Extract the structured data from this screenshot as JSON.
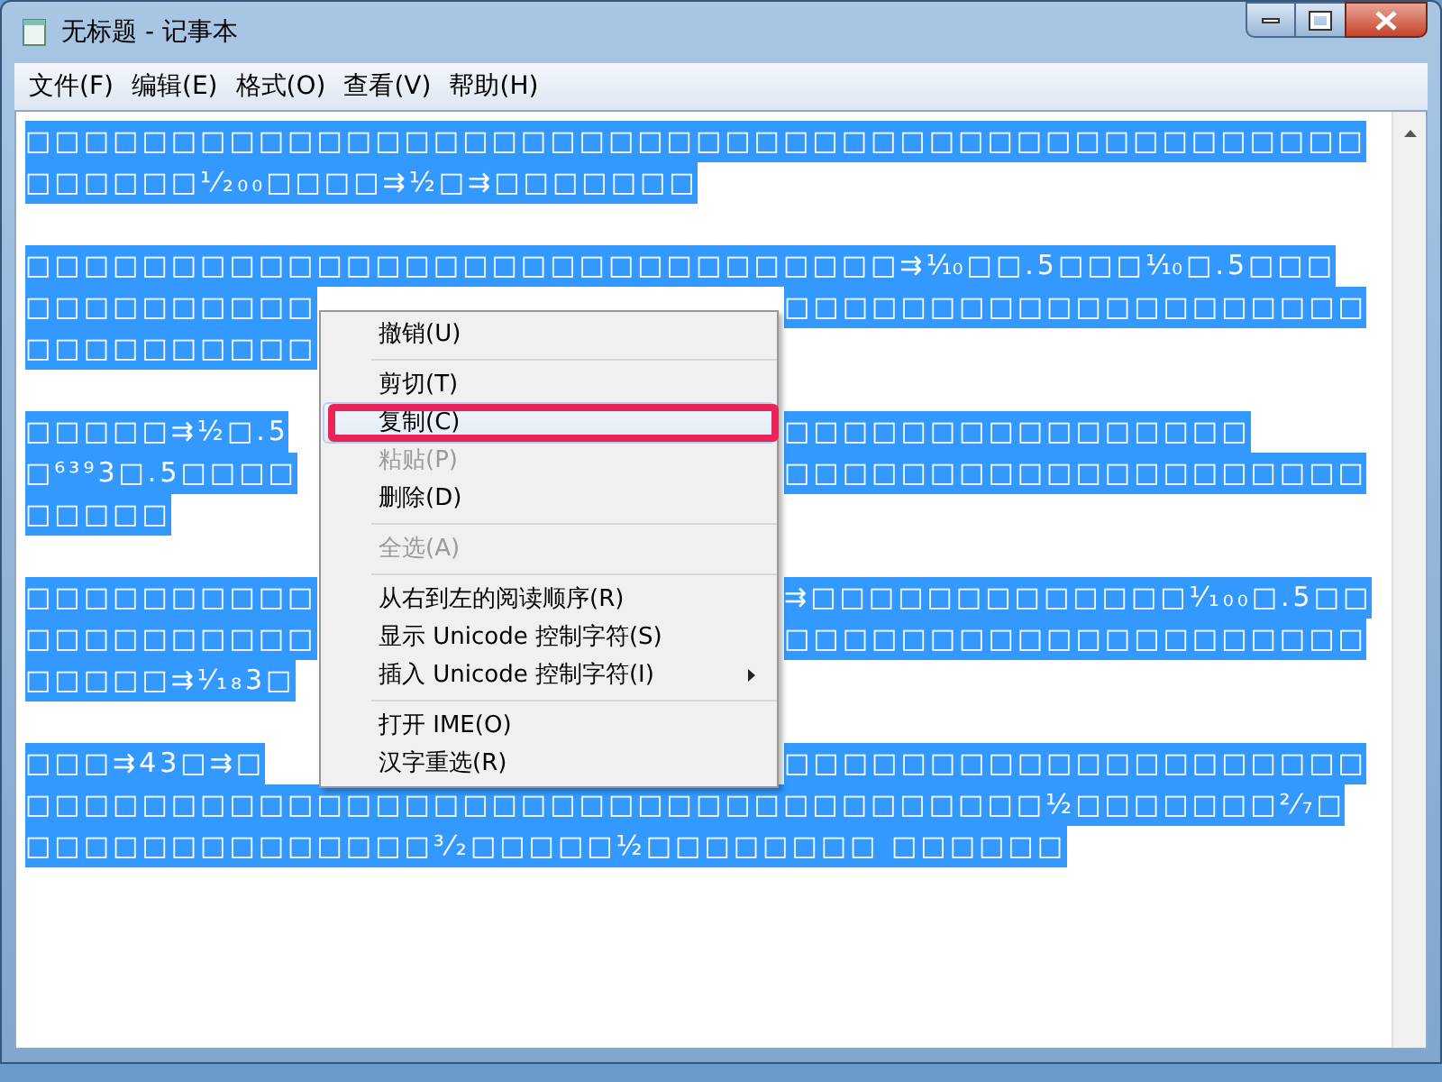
{
  "window": {
    "title": "无标题 - 记事本"
  },
  "menu_bar": [
    {
      "label": "文件(F)"
    },
    {
      "label": "编辑(E)"
    },
    {
      "label": "格式(O)"
    },
    {
      "label": "查看(V)"
    },
    {
      "label": "帮助(H)"
    }
  ],
  "document": {
    "paragraphs": [
      [
        {
          "left": "□□□□□□□□□□□□□□□□□□□□□□□□□□□□□□□□□□□□□□□□□□□□□□"
        },
        {
          "left": "□□□□□□¹⁄₂₀₀□□□□⇉½□⇉□□□□□□□"
        }
      ],
      [
        {
          "left": "□□□□□□□□□□□□□□□□□□□□□□□□□□□□□□⇉⅒□□.5□□□⅒□.5□□□"
        },
        {
          "left": "□□□□□□□□□□",
          "right": "□□□□□□□□□□□□□□□□□□□□"
        },
        {
          "left": "□□□□□□□□□□"
        }
      ],
      [
        {
          "left": "□□□□□⇉½□.5",
          "right": "□□□□□□□□□□□□□□□□"
        },
        {
          "left": "□⁶³⁹3□.5□□□□",
          "right": "□□□□□□□□□□□□□□□□□□□□"
        },
        {
          "left": "□□□□□"
        }
      ],
      [
        {
          "left": "□□□□□□□□□□",
          "right": "⇉□□□□□□□□□□□□□⅟₁₀₀□.5□□"
        },
        {
          "left": "□□□□□□□□□□",
          "right": "□□□□□□□□□□□□□□□□□□□□"
        },
        {
          "left": "□□□□□⇉⅟₁₈3□"
        }
      ],
      [
        {
          "left": "□□□⇉43□⇉□",
          "right": "□□□□□□□□□□□□□□□□□□□□"
        },
        {
          "left": "□□□□□□□□□□□□□□□□□□□□□□□□□□□□□□□□□□□½□□□□□□□²⁄₇□"
        },
        {
          "left": "□□□□□□□□□□□□□□³⁄₂□□□□□½□□□□□□□□ □□□□□□"
        }
      ]
    ]
  },
  "context_menu": {
    "items": [
      {
        "kind": "item",
        "label": "撤销(U)",
        "disabled": false,
        "highlighted": false,
        "submenu": false
      },
      {
        "kind": "separator"
      },
      {
        "kind": "item",
        "label": "剪切(T)",
        "disabled": false,
        "highlighted": false,
        "submenu": false
      },
      {
        "kind": "item",
        "label": "复制(C)",
        "disabled": false,
        "highlighted": true,
        "submenu": false
      },
      {
        "kind": "item",
        "label": "粘贴(P)",
        "disabled": true,
        "highlighted": false,
        "submenu": false
      },
      {
        "kind": "item",
        "label": "删除(D)",
        "disabled": false,
        "highlighted": false,
        "submenu": false
      },
      {
        "kind": "separator"
      },
      {
        "kind": "item",
        "label": "全选(A)",
        "disabled": true,
        "highlighted": false,
        "submenu": false
      },
      {
        "kind": "separator"
      },
      {
        "kind": "item",
        "label": "从右到左的阅读顺序(R)",
        "disabled": false,
        "highlighted": false,
        "submenu": false
      },
      {
        "kind": "item",
        "label": "显示 Unicode 控制字符(S)",
        "disabled": false,
        "highlighted": false,
        "submenu": false
      },
      {
        "kind": "item",
        "label": "插入 Unicode 控制字符(I)",
        "disabled": false,
        "highlighted": false,
        "submenu": true
      },
      {
        "kind": "separator"
      },
      {
        "kind": "item",
        "label": "打开 IME(O)",
        "disabled": false,
        "highlighted": false,
        "submenu": false
      },
      {
        "kind": "item",
        "label": "汉字重选(R)",
        "disabled": false,
        "highlighted": false,
        "submenu": false
      }
    ]
  }
}
